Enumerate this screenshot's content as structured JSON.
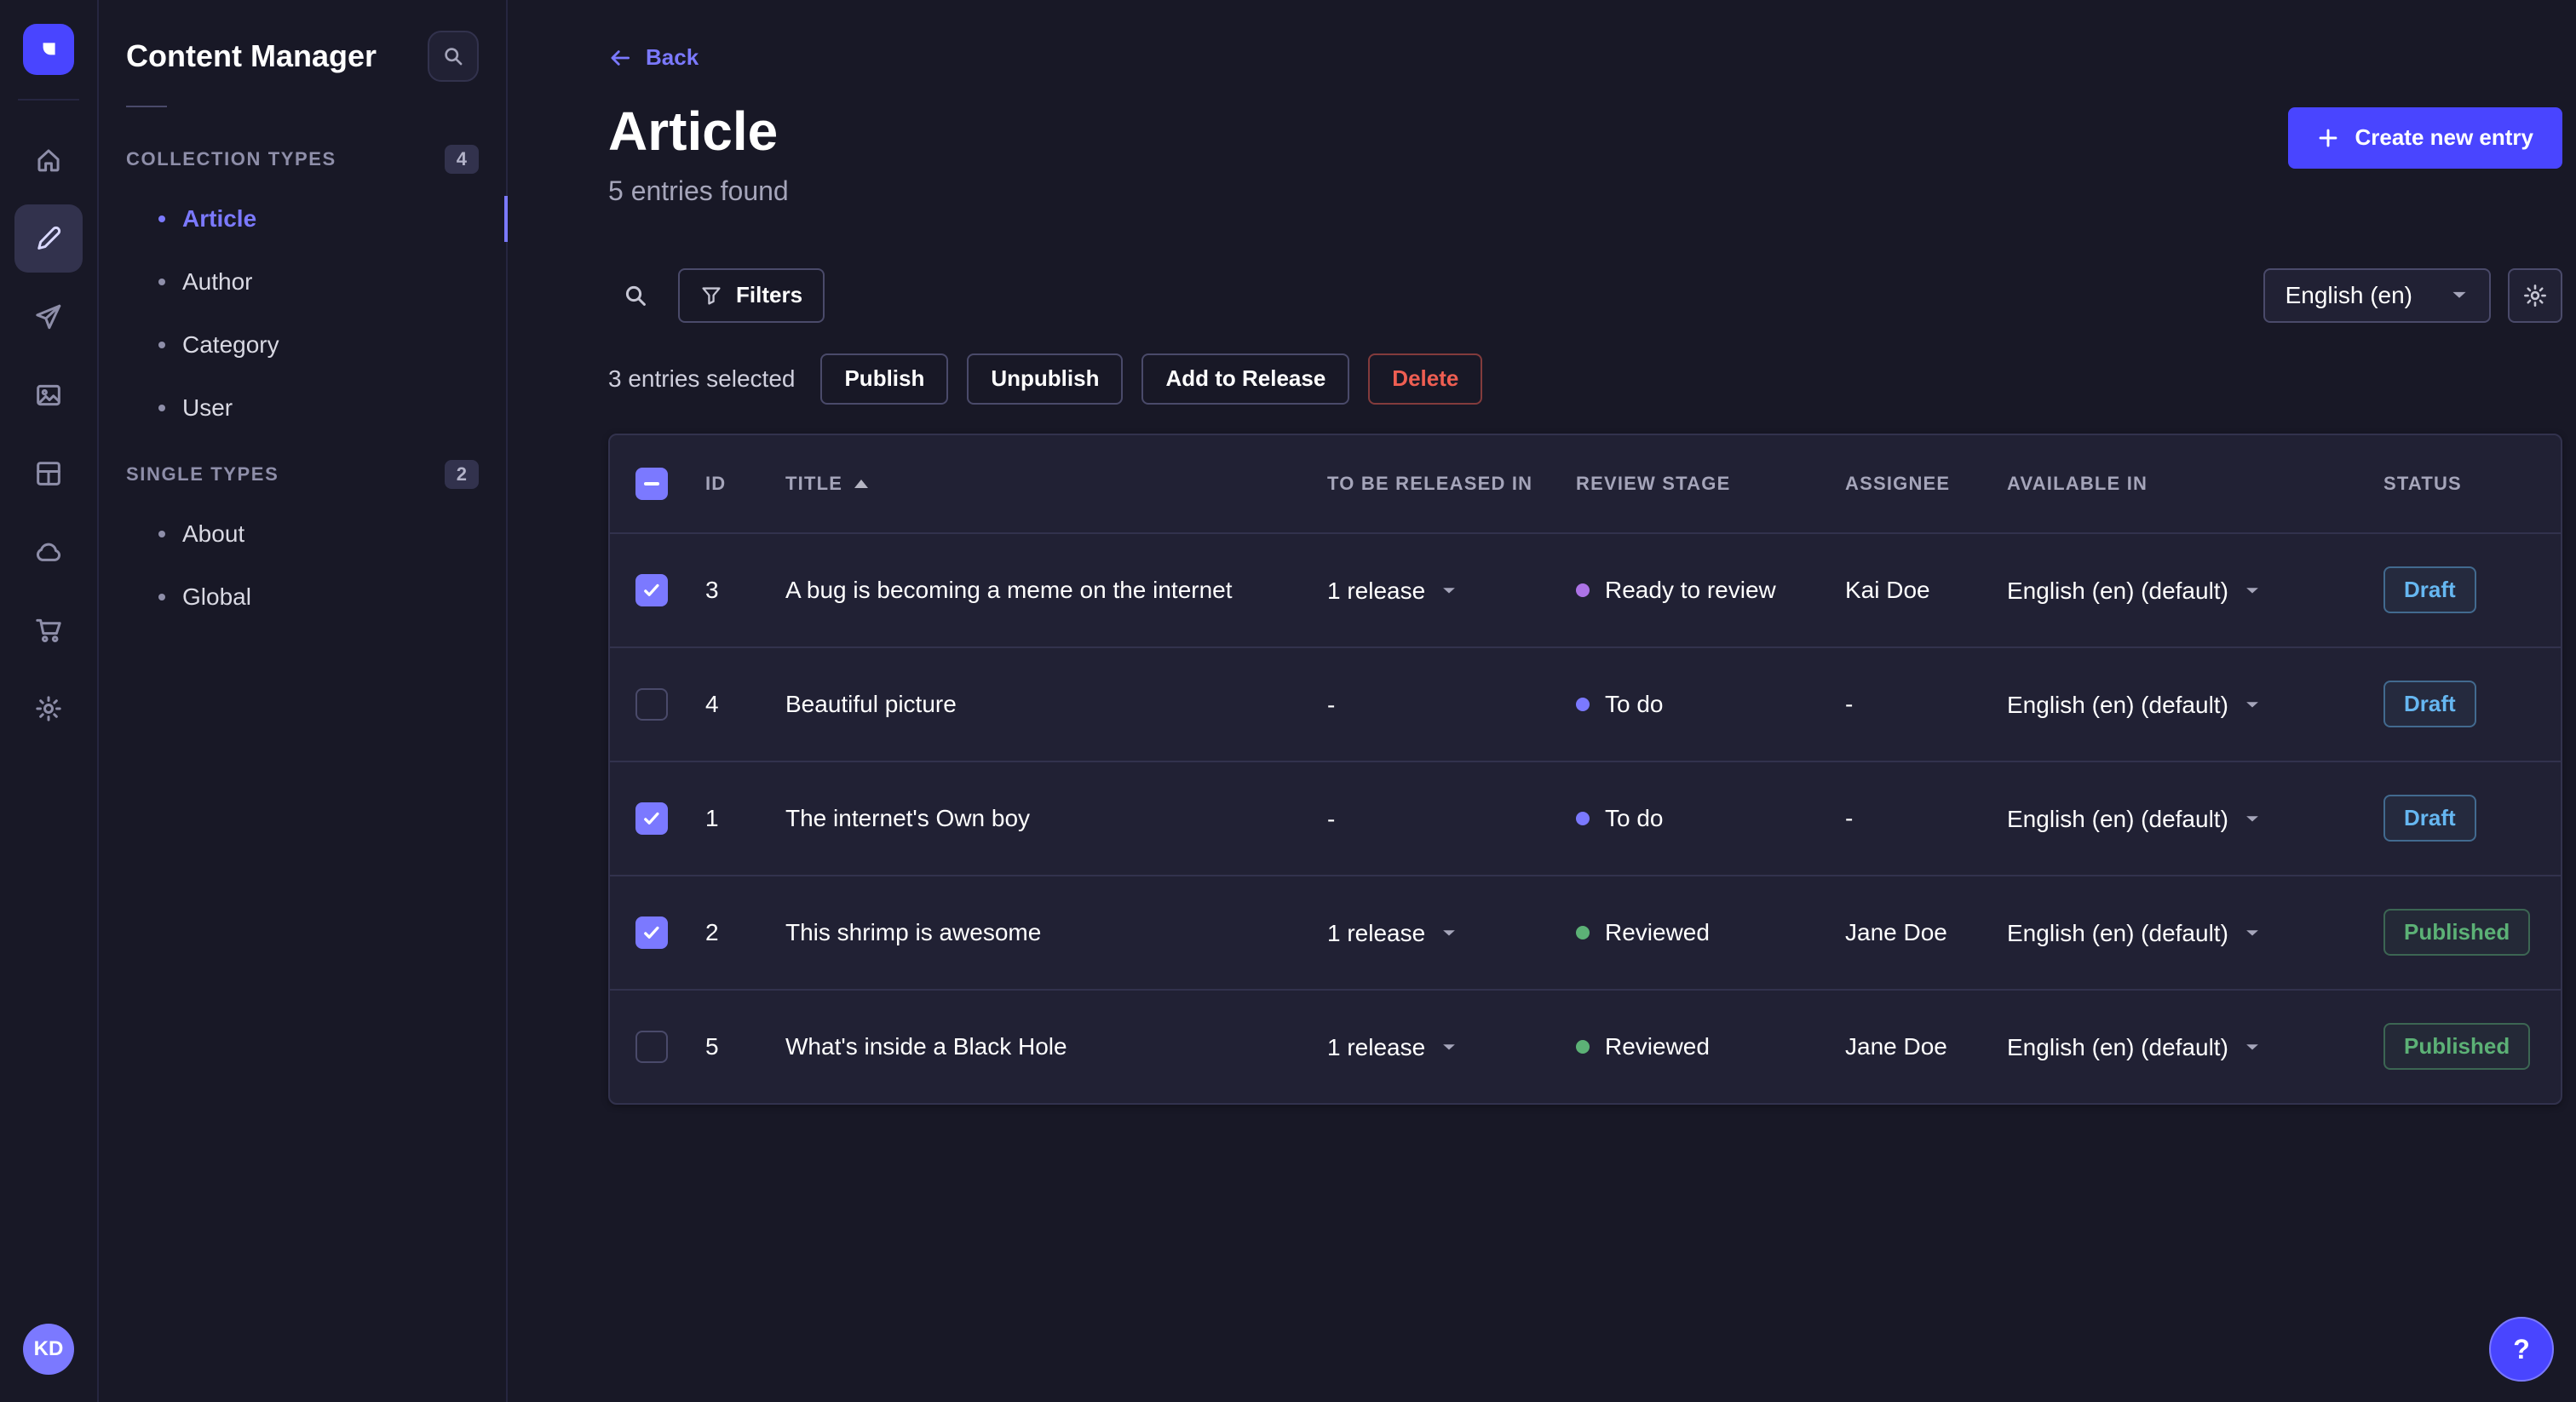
{
  "user": {
    "initials": "KD"
  },
  "help": {
    "label": "?"
  },
  "subnav": {
    "title": "Content Manager",
    "sections": [
      {
        "label": "Collection Types",
        "badge": "4",
        "items": [
          {
            "label": "Article"
          },
          {
            "label": "Author"
          },
          {
            "label": "Category"
          },
          {
            "label": "User"
          }
        ]
      },
      {
        "label": "Single Types",
        "badge": "2",
        "items": [
          {
            "label": "About"
          },
          {
            "label": "Global"
          }
        ]
      }
    ]
  },
  "header": {
    "back": "Back",
    "title": "Article",
    "subtitle": "5 entries found",
    "create_button": "Create new entry"
  },
  "toolbar": {
    "filters": "Filters",
    "locale": "English (en)",
    "selected_text": "3 entries selected",
    "actions": [
      "Publish",
      "Unpublish",
      "Add to Release",
      "Delete"
    ]
  },
  "table": {
    "columns": [
      "ID",
      "TITLE",
      "TO BE RELEASED IN",
      "REVIEW STAGE",
      "ASSIGNEE",
      "AVAILABLE IN",
      "STATUS"
    ],
    "rows": [
      {
        "checked": true,
        "id": "3",
        "title": "A bug is becoming a meme on the internet",
        "release": "1 release",
        "has_release_menu": true,
        "stage": "Ready to review",
        "stage_color": "#ac73e6",
        "assignee": "Kai Doe",
        "locale": "English (en) (default)",
        "status": "Draft",
        "status_kind": "draft"
      },
      {
        "checked": false,
        "id": "4",
        "title": "Beautiful picture",
        "release": "-",
        "has_release_menu": false,
        "stage": "To do",
        "stage_color": "#7b79ff",
        "assignee": "-",
        "locale": "English (en) (default)",
        "status": "Draft",
        "status_kind": "draft"
      },
      {
        "checked": true,
        "id": "1",
        "title": "The internet's Own boy",
        "release": "-",
        "has_release_menu": false,
        "stage": "To do",
        "stage_color": "#7b79ff",
        "assignee": "-",
        "locale": "English (en) (default)",
        "status": "Draft",
        "status_kind": "draft"
      },
      {
        "checked": true,
        "id": "2",
        "title": "This shrimp is awesome",
        "release": "1 release",
        "has_release_menu": true,
        "stage": "Reviewed",
        "stage_color": "#5cb176",
        "assignee": "Jane Doe",
        "locale": "English (en) (default)",
        "status": "Published",
        "status_kind": "published"
      },
      {
        "checked": false,
        "id": "5",
        "title": "What's inside a Black Hole",
        "release": "1 release",
        "has_release_menu": true,
        "stage": "Reviewed",
        "stage_color": "#5cb176",
        "assignee": "Jane Doe",
        "locale": "English (en) (default)",
        "status": "Published",
        "status_kind": "published"
      }
    ]
  },
  "colors": {
    "primary": "#4945ff",
    "primary_light": "#7b79ff",
    "draft": "#66b7f1",
    "published": "#5cb176",
    "danger": "#ee5e52",
    "stage_todo": "#7b79ff",
    "stage_ready": "#ac73e6",
    "stage_reviewed": "#5cb176"
  }
}
